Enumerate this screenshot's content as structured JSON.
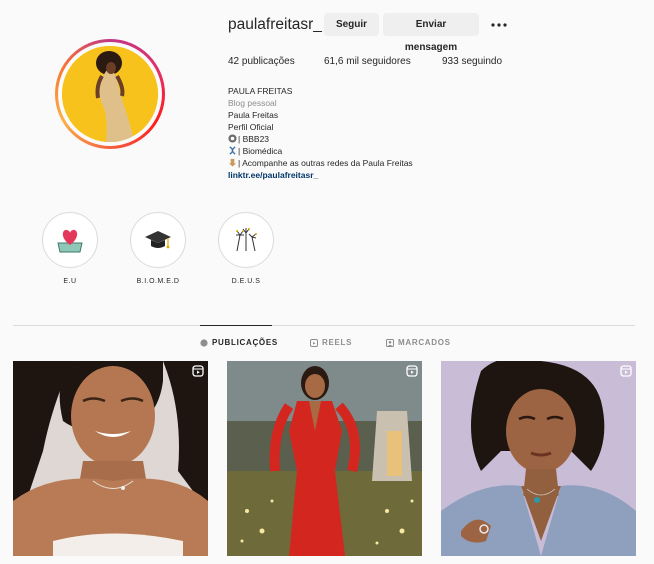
{
  "profile": {
    "username": "paulafreitasr_",
    "follow_label": "Seguir",
    "message_label": "Enviar mensagem",
    "posts_count": "42 publicações",
    "followers_count": "61,6 mil seguidores",
    "following_count": "933 seguindo"
  },
  "bio": {
    "name": "PAULA FREITAS",
    "category": "Blog pessoal",
    "line1": "Paula Freitas",
    "line2": "Perfil Oficial",
    "line3": "| BBB23",
    "line4": "| Biomédica",
    "line5": "| Acompanhe as outras redes da Paula Freitas",
    "link": "linktr.ee/paulafreitasr_"
  },
  "highlights": [
    {
      "label": "E.U",
      "icon": "heart-box-icon"
    },
    {
      "label": "B.I.O.M.E.D",
      "icon": "graduation-cap-icon"
    },
    {
      "label": "D.E.U.S",
      "icon": "fireworks-icon"
    }
  ],
  "tabs": [
    {
      "label": "PUBLICAÇÕES",
      "icon": "grid-icon",
      "active": true
    },
    {
      "label": "REELS",
      "icon": "reels-icon",
      "active": false
    },
    {
      "label": "MARCADOS",
      "icon": "tagged-icon",
      "active": false
    }
  ],
  "posts": [
    {
      "type": "reel",
      "description": "smiling-portrait-white-top"
    },
    {
      "type": "reel",
      "description": "red-jumpsuit-garden-lights"
    },
    {
      "type": "reel",
      "description": "portrait-gray-blazer"
    }
  ],
  "colors": {
    "button_bg": "#efefef",
    "text": "#262626",
    "muted": "#8e8e8e",
    "link": "#00376b",
    "avatar_bg": "#f7c21c"
  }
}
